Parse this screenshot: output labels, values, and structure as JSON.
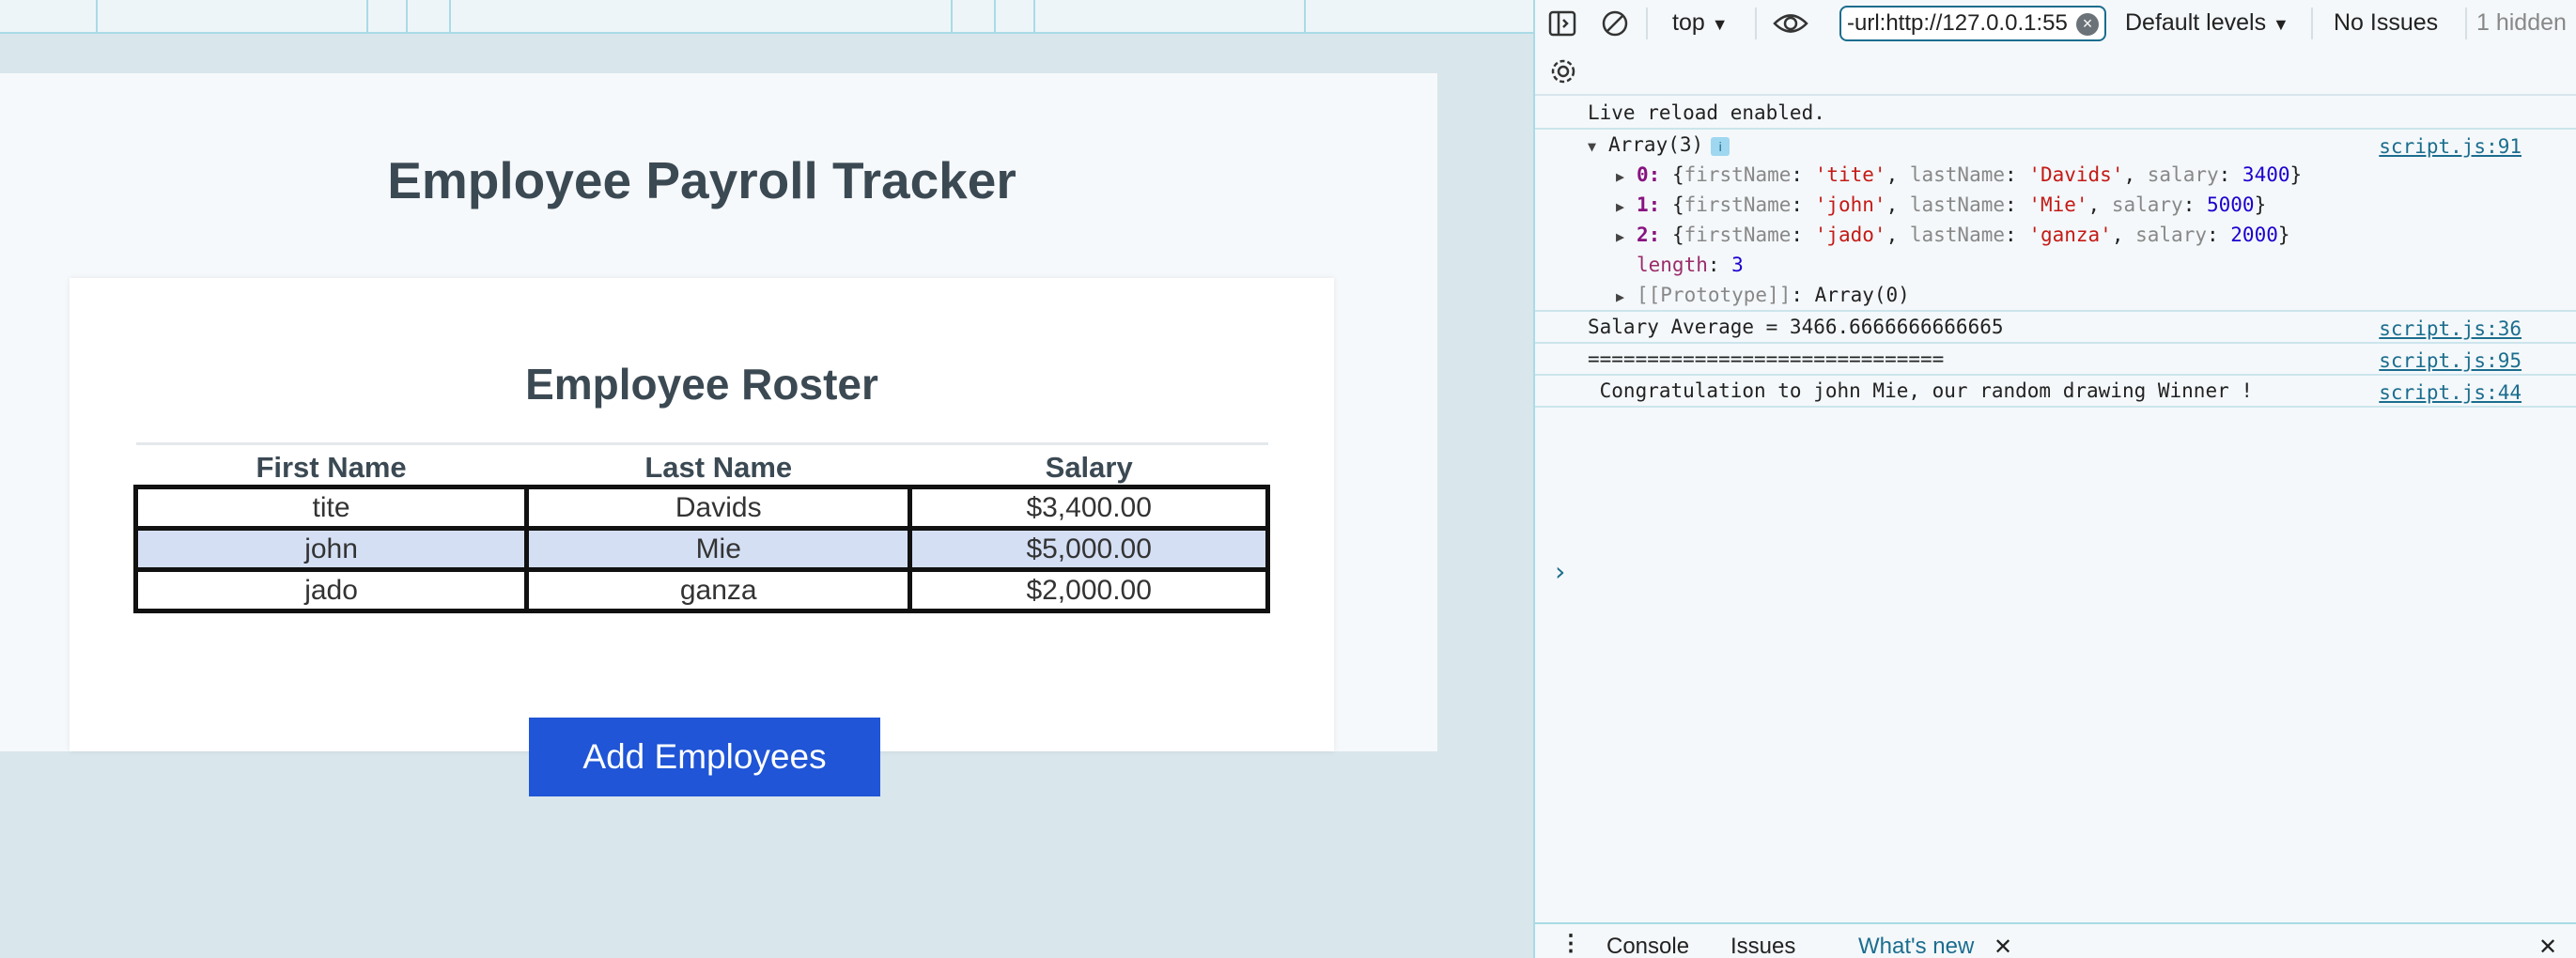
{
  "page": {
    "title": "Employee Payroll Tracker",
    "roster_title": "Employee Roster",
    "columns": [
      "First Name",
      "Last Name",
      "Salary"
    ],
    "rows": [
      {
        "first": "tite",
        "last": "Davids",
        "salary": "$3,400.00"
      },
      {
        "first": "john",
        "last": "Mie",
        "salary": "$5,000.00"
      },
      {
        "first": "jado",
        "last": "ganza",
        "salary": "$2,000.00"
      }
    ],
    "add_button": "Add Employees"
  },
  "devtools": {
    "context": "top",
    "filter_value": "-url:http://127.0.0.1:55",
    "levels": "Default levels",
    "issues": "No Issues",
    "hidden": "1 hidden",
    "messages": {
      "live_reload": "Live reload enabled.",
      "array_label": "Array(3)",
      "array_src": "script.js:91",
      "items": [
        {
          "idx": "0",
          "first": "'tite'",
          "last": "'Davids'",
          "salary": "3400"
        },
        {
          "idx": "1",
          "first": "'john'",
          "last": "'Mie'",
          "salary": "5000"
        },
        {
          "idx": "2",
          "first": "'jado'",
          "last": "'ganza'",
          "salary": "2000"
        }
      ],
      "length_key": "length",
      "length_val": "3",
      "prototype": "[[Prototype]]",
      "prototype_val": "Array(0)",
      "average": "Salary Average = 3466.6666666666665",
      "average_src": "script.js:36",
      "separator": "==============================",
      "separator_src": "script.js:95",
      "winner": " Congratulation to john Mie, our random drawing Winner !",
      "winner_src": "script.js:44"
    },
    "drawer_tabs": [
      "Console",
      "Issues",
      "What's new"
    ]
  }
}
